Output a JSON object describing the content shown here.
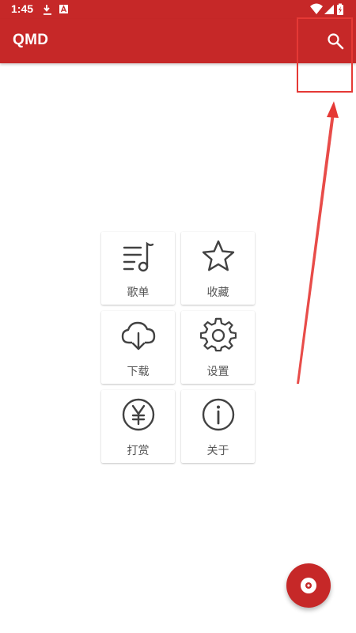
{
  "status_bar": {
    "time": "1:45",
    "left_icons": [
      "download-icon",
      "a-box-icon"
    ],
    "right_icons": [
      "wifi-icon",
      "signal-icon",
      "battery-charging-icon"
    ]
  },
  "app_bar": {
    "title": "QMD",
    "action_icon": "search-icon"
  },
  "menu": [
    {
      "label": "歌单",
      "icon": "playlist-icon"
    },
    {
      "label": "收藏",
      "icon": "star-icon"
    },
    {
      "label": "下载",
      "icon": "cloud-download-icon"
    },
    {
      "label": "设置",
      "icon": "gear-icon"
    },
    {
      "label": "打赏",
      "icon": "yen-icon"
    },
    {
      "label": "关于",
      "icon": "info-icon"
    }
  ],
  "fab": {
    "icon": "disc-icon"
  },
  "colors": {
    "primary": "#c62828",
    "annotation": "#e53935",
    "icon": "#424242",
    "label": "#555555"
  }
}
